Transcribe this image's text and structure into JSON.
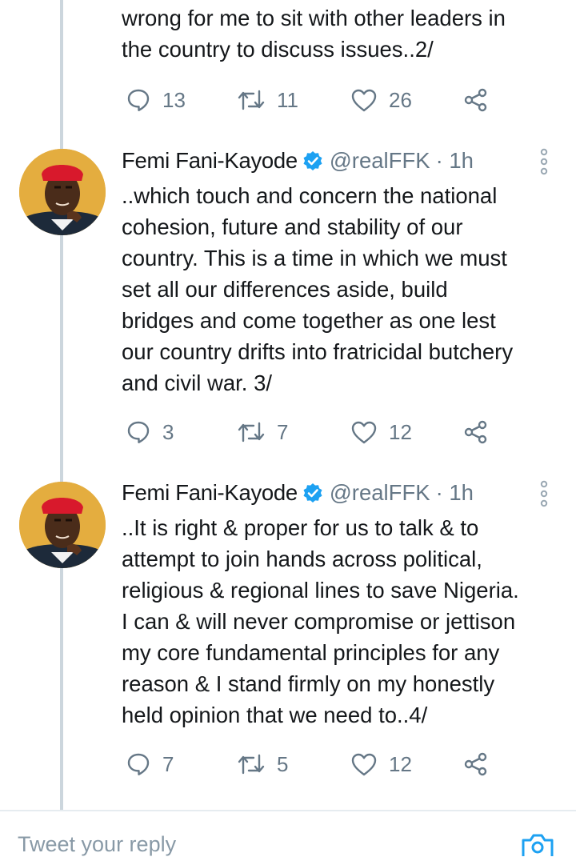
{
  "tweets": [
    {
      "text": "wrong for me to sit with other leaders in\nthe country to discuss issues..2/",
      "replies": "13",
      "retweets": "11",
      "likes": "26"
    },
    {
      "author_name": "Femi Fani-Kayode",
      "handle": "@realFFK",
      "time": "· 1h",
      "text": "..which touch and concern the national\ncohesion, future and stability of our\ncountry. This is a time in which we must\nset all our differences aside, build\nbridges and come together as one lest\nour country drifts into fratricidal butchery\nand civil war. 3/",
      "replies": "3",
      "retweets": "7",
      "likes": "12"
    },
    {
      "author_name": "Femi Fani-Kayode",
      "handle": "@realFFK",
      "time": "· 1h",
      "text": "..It is right & proper for us to talk & to\nattempt to join hands across political,\nreligious & regional lines to save Nigeria.\nI can & will never compromise or jettison\nmy core fundamental principles for any\nreason & I stand firmly on my honestly\nheld opinion that we need to..4/",
      "replies": "7",
      "retweets": "5",
      "likes": "12"
    }
  ],
  "composer": {
    "placeholder": "Tweet your reply"
  },
  "icons": {
    "reply": "speech-bubble-icon",
    "retweet": "retweet-arrows-icon",
    "like": "heart-icon",
    "share": "share-nodes-icon",
    "more": "vertical-dots-icon",
    "verified": "verified-badge-icon",
    "camera": "camera-icon"
  },
  "colors": {
    "icon_gray": "#657786",
    "verified_blue": "#1da1f2",
    "thread_line": "#ccd6dd"
  }
}
